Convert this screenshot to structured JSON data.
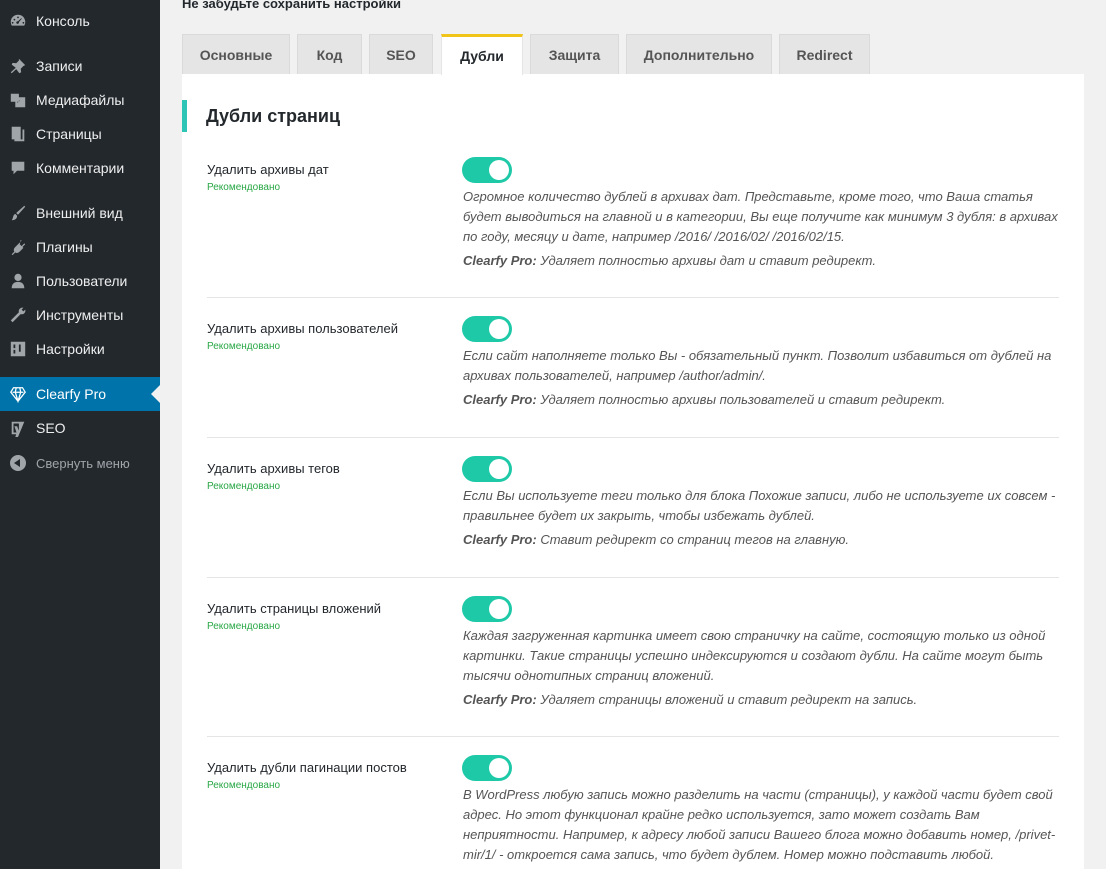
{
  "notice": "Не забудьте сохранить настройки",
  "sidebar": {
    "items": [
      {
        "label": "Консоль",
        "icon": "dashboard-icon"
      },
      {
        "label": "Записи",
        "icon": "pin-icon"
      },
      {
        "label": "Медиафайлы",
        "icon": "media-icon"
      },
      {
        "label": "Страницы",
        "icon": "pages-icon"
      },
      {
        "label": "Комментарии",
        "icon": "comment-icon"
      },
      {
        "label": "Внешний вид",
        "icon": "brush-icon"
      },
      {
        "label": "Плагины",
        "icon": "plugin-icon"
      },
      {
        "label": "Пользователи",
        "icon": "user-icon"
      },
      {
        "label": "Инструменты",
        "icon": "wrench-icon"
      },
      {
        "label": "Настройки",
        "icon": "settings-icon"
      },
      {
        "label": "Clearfy Pro",
        "icon": "diamond-icon"
      },
      {
        "label": "SEO",
        "icon": "yoast-icon"
      },
      {
        "label": "Свернуть меню",
        "icon": "collapse-icon"
      }
    ]
  },
  "tabs": [
    {
      "label": "Основные"
    },
    {
      "label": "Код"
    },
    {
      "label": "SEO"
    },
    {
      "label": "Дубли"
    },
    {
      "label": "Защита"
    },
    {
      "label": "Дополнительно"
    },
    {
      "label": "Redirect"
    }
  ],
  "section_title": "Дубли страниц",
  "options": [
    {
      "label": "Удалить архивы дат",
      "recommended": "Рекомендовано",
      "enabled": true,
      "description": "Огромное количество дублей в архивах дат. Представьте, кроме того, что Ваша статья будет выводиться на главной и в категории, Вы еще получите как минимум 3 дубля: в архивах по году, месяцу и дате, например /2016/ /2016/02/ /2016/02/15.",
      "pro_label": "Clearfy Pro:",
      "pro_text": " Удаляет полностью архивы дат и ставит редирект."
    },
    {
      "label": "Удалить архивы пользователей",
      "recommended": "Рекомендовано",
      "enabled": true,
      "description": "Если сайт наполняете только Вы - обязательный пункт. Позволит избавиться от дублей на архивах пользователей, например /author/admin/.",
      "pro_label": "Clearfy Pro:",
      "pro_text": " Удаляет полностью архивы пользователей и ставит редирект."
    },
    {
      "label": "Удалить архивы тегов",
      "recommended": "Рекомендовано",
      "enabled": true,
      "description": "Если Вы используете теги только для блока Похожие записи, либо не используете их совсем - правильнее будет их закрыть, чтобы избежать дублей.",
      "pro_label": "Clearfy Pro:",
      "pro_text": " Ставит редирект со страниц тегов на главную."
    },
    {
      "label": "Удалить страницы вложений",
      "recommended": "Рекомендовано",
      "enabled": true,
      "description": "Каждая загруженная картинка имеет свою страничку на сайте, состоящую только из одной картинки. Такие страницы успешно индексируются и создают дубли. На сайте могут быть тысячи однотипных страниц вложений.",
      "pro_label": "Clearfy Pro:",
      "pro_text": " Удаляет страницы вложений и ставит редирект на запись."
    },
    {
      "label": "Удалить дубли пагинации постов",
      "recommended": "Рекомендовано",
      "enabled": true,
      "description": "В WordPress любую запись можно разделить на части (страницы), у каждой части будет свой адрес. Но этот функционал крайне редко используется, зато может создать Вам неприятности. Например, к адресу любой записи Вашего блога можно добавить номер, /privet-mir/1/ - откроется сама запись, что будет дублем. Номер можно подставить любой.",
      "pro_label": "",
      "pro_text": ""
    }
  ]
}
